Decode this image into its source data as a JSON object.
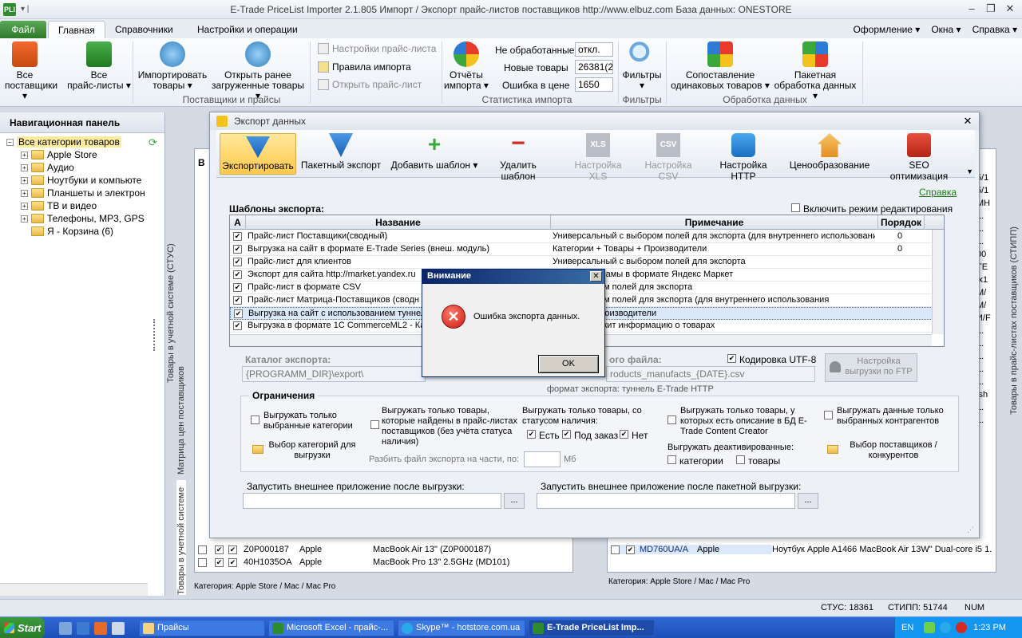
{
  "app": {
    "logo": "PLI",
    "quick_access": "▾ |",
    "title": "E-Trade PriceList Importer 2.1.805     Импорт / Экспорт прайс-листов поставщиков     http://www.elbuz.com     База данных: ONESTORE",
    "win_min": "–",
    "win_max": "❐",
    "win_close": "✕"
  },
  "ribbon_tabs": {
    "file": "Файл",
    "main": "Главная",
    "refs": "Справочники",
    "settings": "Настройки и операции",
    "style": "Оформление",
    "window": "Окна",
    "help": "Справка"
  },
  "ribbon": {
    "all_suppliers": [
      "Все",
      "поставщики ▾"
    ],
    "all_pricelists": [
      "Все",
      "прайс-листы ▾"
    ],
    "imported_goods": [
      "Импортировать",
      "товары ▾"
    ],
    "open_loaded": [
      "Открыть ранее",
      "загруженные товары ▾"
    ],
    "group_suppliers": "Поставщики и прайсы",
    "pl_settings": "Настройки прайс-листа",
    "import_rules": "Правила импорта",
    "open_pl": "Открыть прайс-лист",
    "import_reports": [
      "Отчёты",
      "импорта ▾"
    ],
    "stat_labels": [
      "Не обработанные",
      "Новые товары",
      "Ошибка в цене"
    ],
    "stat_values": [
      "откл.",
      "26381(25",
      "1650"
    ],
    "group_stats": "Статистика импорта",
    "filters": [
      "Фильтры",
      "▾"
    ],
    "group_filters": "Фильтры",
    "matching": [
      "Сопоставление",
      "одинаковых товаров ▾"
    ],
    "batch": [
      "Пакетная",
      "обработка данных ▾"
    ],
    "group_processing": "Обработка данных"
  },
  "nav": {
    "title": "Навигационная панель",
    "root": "Все категории товаров",
    "items": [
      "Apple Store",
      "Аудио",
      "Ноутбуки и компьюте",
      "Планшеты и электрон",
      "ТВ и видео",
      "Телефоны, MP3, GPS",
      "Я - Корзина (6)"
    ]
  },
  "side": {
    "left_strip1": "Товары в учетной системе (СТУС)",
    "left_strip2": "Матрица цен поставщиков",
    "left_strip3": "Товары в учетной системе",
    "right_strip": "Товары в прайс-листах поставщиков (СТИПП)"
  },
  "bg_left": {
    "col_b": "В",
    "rows": [
      {
        "sku": "Z0P000187",
        "brand": "Apple",
        "name": "MacBook Air 13\" (Z0P000187)"
      },
      {
        "sku": "40H1035OA",
        "brand": "Apple",
        "name": "MacBook Pro 13\" 2.5GHz (MD101)"
      }
    ],
    "category": "Категория: Apple Store / Mac / Mac Pro"
  },
  "bg_right": {
    "rows": [
      {
        "sku": "MD760UA/A",
        "brand": "Apple",
        "name": "Ноутбук Apple A1466 MacBook Air 13W\" Dual-core i5 1."
      }
    ],
    "category": "Категория: Apple Store / Mac / Mac Pro",
    "edge": [
      "5/1",
      "5/1",
      "МН",
      "1.",
      "1.",
      "1.",
      "00",
      "ТЕ",
      "lx1",
      "М/",
      "М/",
      "И/F",
      "1.",
      "1.",
      "1.",
      "1.",
      "1.",
      "ish",
      "1.",
      "1."
    ]
  },
  "dialog": {
    "title": "Экспорт данных",
    "close": "✕",
    "toolbar": {
      "export": "Экспортировать",
      "batch_export": "Пакетный экспорт",
      "add_template": "Добавить шаблон ▾",
      "delete_template": "Удалить шаблон",
      "xls_settings": "Настройка XLS",
      "csv_settings": "Настройка CSV",
      "http_settings": "Настройка HTTP",
      "pricing": "Ценообразование",
      "seo": "SEO оптимизация",
      "xls_badge": "XLS",
      "csv_badge": "CSV"
    },
    "help_link": "Справка",
    "templates_title": "Шаблоны экспорта:",
    "edit_mode": "Включить режим редактирования",
    "grid_headers": {
      "a": "A",
      "name": "Название",
      "note": "Примечание",
      "order": "Порядок"
    },
    "rows": [
      {
        "name": "Прайс-лист Поставщики(сводный)",
        "note": "Универсальный с выбором полей для экспорта (для внутреннего использования",
        "order": "0"
      },
      {
        "name": "Выгрузка на сайт в формате E-Trade Series (внеш. модуль)",
        "note": "Категории + Товары + Производители",
        "order": "0"
      },
      {
        "name": "Прайс-лист для клиентов",
        "note": "Универсальный с выбором полей для экспорта",
        "order": ""
      },
      {
        "name": "Экспорт для сайта http://market.yandex.ru",
        "note": "ров для рекламы в формате Яндекс Маркет",
        "order": ""
      },
      {
        "name": "Прайс-лист в формате CSV",
        "note": "ый с выбором полей для экспорта",
        "order": ""
      },
      {
        "name": "Прайс-лист Матрица-Поставщиков (сводн",
        "note": "ый с выбором полей для экспорта (для внутреннего использования",
        "order": ""
      },
      {
        "name": "Выгрузка на сайт с использованием туннел",
        "note": "Товары + Производители",
        "order": ""
      },
      {
        "name": "Выгрузка в формате 1С CommerceML2 - Ка",
        "note": "файл содержит информацию о товарах",
        "order": ""
      }
    ],
    "catalog_label": "Каталог экспорта:",
    "catalog_value": "{PROGRAMM_DIR}\\export\\",
    "file_label": "ого файла:",
    "file_value": "roducts_manufacts_{DATE}.csv",
    "utf8": "Кодировка UTF-8",
    "ftp": "Настройка выгрузки по FTP",
    "format_note": "формат экспорта: туннель E-Trade HTTP",
    "restrictions": {
      "title": "Ограничения",
      "only_categories": "Выгружать только выбранные категории",
      "select_categories": "Выбор категорий для выгрузки",
      "only_found": "Выгружать только товары, которые найдены в прайс-листах поставщиков (без учёта статуса наличия)",
      "status_title": "Выгружать только товары, со статусом наличия:",
      "status_yes": "Есть",
      "status_order": "Под заказ",
      "status_no": "Нет",
      "split_label": "Разбить файл экспорта на части, по:",
      "split_unit": "Мб",
      "with_desc": "Выгружать только товары, у которых есть описание в БД E-Trade Content Creator",
      "deactivated": "Выгружать деактивированные:",
      "deact_cat": "категории",
      "deact_goods": "товары",
      "only_counterparties": "Выгружать данные только выбранных контрагентов",
      "select_suppliers": "Выбор поставщиков / конкурентов"
    },
    "run_after": "Запустить внешнее приложение после выгрузки:",
    "run_after_batch": "Запустить внешнее приложение после пакетной выгрузки:",
    "dots": "..."
  },
  "alert": {
    "title": "Внимание",
    "close": "✕",
    "icon": "✕",
    "message": "Ошибка экспорта данных.",
    "ok": "OK"
  },
  "statusbar": {
    "stus": "СТУС: 18361",
    "stipp": "СТИПП: 51744",
    "num": "NUM"
  },
  "taskbar": {
    "start": "Start",
    "tasks": [
      "Прайсы",
      "Microsoft Excel - прайс-...",
      "Skype™ - hotstore.com.ua",
      "E-Trade PriceList Imp..."
    ],
    "lang": "EN",
    "time": "1:23 PM"
  },
  "colors": {
    "accent_green": "#2d7a2b",
    "selection": "#dbe8f9",
    "taskbar": "#1c4fb8",
    "error_red": "#c81a0f"
  }
}
